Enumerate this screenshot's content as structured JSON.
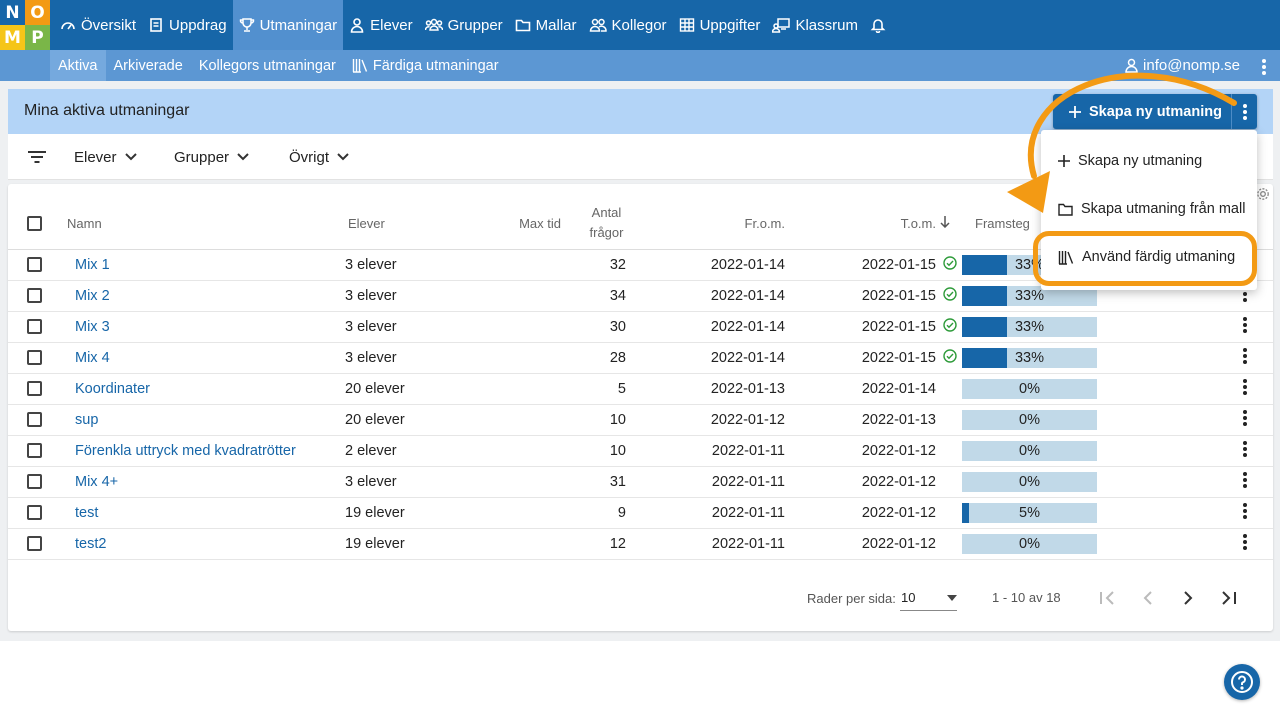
{
  "logo": {
    "letters": [
      "N",
      "O",
      "M",
      "P"
    ],
    "colors": [
      "#1766a8",
      "#f39a14",
      "#f5c518",
      "#7ab648"
    ]
  },
  "nav": {
    "items": [
      {
        "label": "Översikt",
        "icon": "dashboard-icon"
      },
      {
        "label": "Uppdrag",
        "icon": "assignment-icon"
      },
      {
        "label": "Utmaningar",
        "icon": "trophy-icon",
        "active": true
      },
      {
        "label": "Elever",
        "icon": "person-icon"
      },
      {
        "label": "Grupper",
        "icon": "group-icon"
      },
      {
        "label": "Mallar",
        "icon": "folder-icon"
      },
      {
        "label": "Kollegor",
        "icon": "colleagues-icon"
      },
      {
        "label": "Uppgifter",
        "icon": "grid-icon"
      },
      {
        "label": "Klassrum",
        "icon": "classroom-icon"
      }
    ]
  },
  "subnav": {
    "items": [
      {
        "label": "Aktiva",
        "active": true
      },
      {
        "label": "Arkiverade"
      },
      {
        "label": "Kollegors utmaningar"
      },
      {
        "label": "Färdiga utmaningar",
        "icon": "library-icon"
      }
    ],
    "user": "info@nomp.se"
  },
  "header": {
    "title": "Mina aktiva utmaningar",
    "create_label": "Skapa ny utmaning"
  },
  "filters": [
    "Elever",
    "Grupper",
    "Övrigt"
  ],
  "table": {
    "columns": {
      "name": "Namn",
      "students": "Elever",
      "maxtime": "Max tid",
      "questions_1": "Antal",
      "questions_2": "frågor",
      "from": "Fr.o.m.",
      "to": "T.o.m.",
      "progress": "Framsteg"
    },
    "rows": [
      {
        "name": "Mix 1",
        "students": "3 elever",
        "questions": "32",
        "from": "2022-01-14",
        "to": "2022-01-15",
        "done": true,
        "progress": 33,
        "progress_label": "33%"
      },
      {
        "name": "Mix 2",
        "students": "3 elever",
        "questions": "34",
        "from": "2022-01-14",
        "to": "2022-01-15",
        "done": true,
        "progress": 33,
        "progress_label": "33%"
      },
      {
        "name": "Mix 3",
        "students": "3 elever",
        "questions": "30",
        "from": "2022-01-14",
        "to": "2022-01-15",
        "done": true,
        "progress": 33,
        "progress_label": "33%"
      },
      {
        "name": "Mix 4",
        "students": "3 elever",
        "questions": "28",
        "from": "2022-01-14",
        "to": "2022-01-15",
        "done": true,
        "progress": 33,
        "progress_label": "33%"
      },
      {
        "name": "Koordinater",
        "students": "20 elever",
        "questions": "5",
        "from": "2022-01-13",
        "to": "2022-01-14",
        "done": false,
        "progress": 0,
        "progress_label": "0%"
      },
      {
        "name": "sup",
        "students": "20 elever",
        "questions": "10",
        "from": "2022-01-12",
        "to": "2022-01-13",
        "done": false,
        "progress": 0,
        "progress_label": "0%"
      },
      {
        "name": "Förenkla uttryck med kvadratrötter",
        "students": "2 elever",
        "questions": "10",
        "from": "2022-01-11",
        "to": "2022-01-12",
        "done": false,
        "progress": 0,
        "progress_label": "0%"
      },
      {
        "name": "Mix 4+",
        "students": "3 elever",
        "questions": "31",
        "from": "2022-01-11",
        "to": "2022-01-12",
        "done": false,
        "progress": 0,
        "progress_label": "0%"
      },
      {
        "name": "test",
        "students": "19 elever",
        "questions": "9",
        "from": "2022-01-11",
        "to": "2022-01-12",
        "done": false,
        "progress": 5,
        "progress_label": "5%"
      },
      {
        "name": "test2",
        "students": "19 elever",
        "questions": "12",
        "from": "2022-01-11",
        "to": "2022-01-12",
        "done": false,
        "progress": 0,
        "progress_label": "0%"
      }
    ]
  },
  "pagination": {
    "rows_per_page_label": "Rader per sida:",
    "rows_per_page": "10",
    "range": "1 - 10 av 18"
  },
  "menu": {
    "items": [
      {
        "label": "Skapa ny utmaning",
        "icon": "plus-icon"
      },
      {
        "label": "Skapa utmaning från mall",
        "icon": "folder-icon"
      },
      {
        "label": "Använd färdig utmaning",
        "icon": "library-icon"
      }
    ]
  },
  "colors": {
    "primary": "#1766a8",
    "highlight": "#f39a14",
    "success": "#2e9b3a"
  }
}
